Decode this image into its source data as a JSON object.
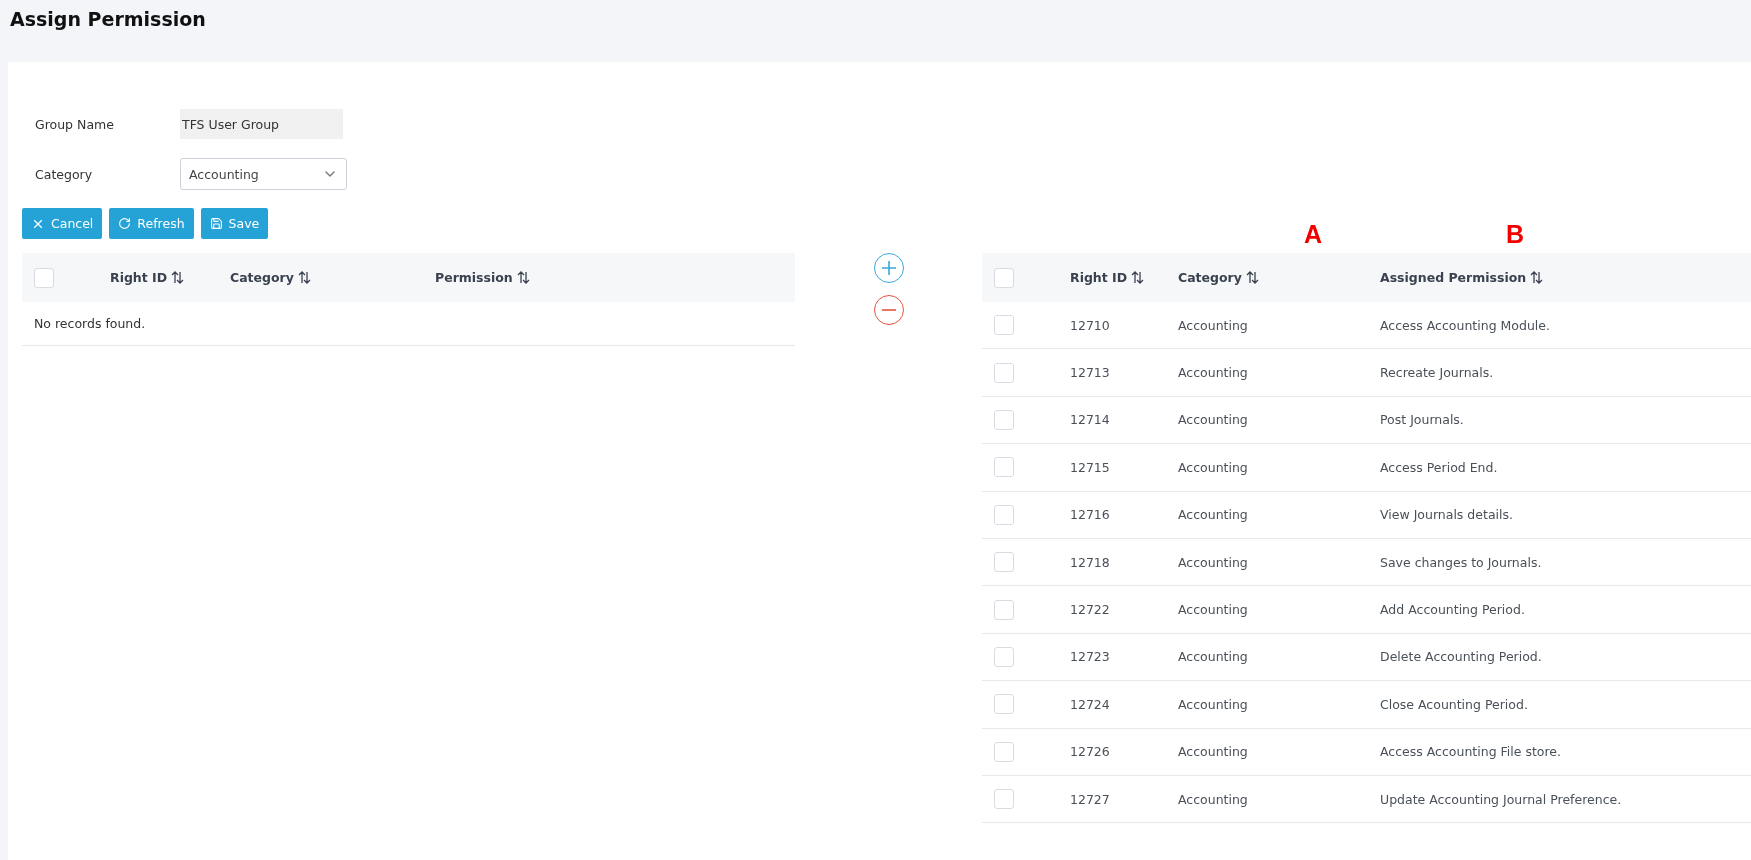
{
  "page_title": "Assign Permission",
  "form": {
    "group_name": {
      "label": "Group Name",
      "value": "TFS User Group"
    },
    "category": {
      "label": "Category",
      "value": "Accounting"
    }
  },
  "buttons": [
    {
      "kind": "cancel",
      "label": "Cancel"
    },
    {
      "kind": "refresh",
      "label": "Refresh"
    },
    {
      "kind": "save",
      "label": "Save"
    }
  ],
  "available_table": {
    "select_all_checked": false,
    "columns": [
      "Right ID",
      "Category",
      "Permission"
    ],
    "empty_message": "No records found."
  },
  "assigned_table": {
    "select_all_checked": false,
    "columns": [
      {
        "label": "Right ID"
      },
      {
        "label": "Category",
        "annotation": "A"
      },
      {
        "label": "Assigned Permission",
        "annotation": "B"
      }
    ],
    "rows": [
      {
        "id": "12710",
        "category": "Accounting",
        "permission": "Access Accounting Module.",
        "checked": false
      },
      {
        "id": "12713",
        "category": "Accounting",
        "permission": "Recreate Journals.",
        "checked": false
      },
      {
        "id": "12714",
        "category": "Accounting",
        "permission": "Post Journals.",
        "checked": false
      },
      {
        "id": "12715",
        "category": "Accounting",
        "permission": "Access Period End.",
        "checked": false
      },
      {
        "id": "12716",
        "category": "Accounting",
        "permission": "View Journals details.",
        "checked": false
      },
      {
        "id": "12718",
        "category": "Accounting",
        "permission": "Save changes to Journals.",
        "checked": false
      },
      {
        "id": "12722",
        "category": "Accounting",
        "permission": "Add Accounting Period.",
        "checked": false
      },
      {
        "id": "12723",
        "category": "Accounting",
        "permission": "Delete Accounting Period.",
        "checked": false
      },
      {
        "id": "12724",
        "category": "Accounting",
        "permission": "Close Acounting Period.",
        "checked": false
      },
      {
        "id": "12726",
        "category": "Accounting",
        "permission": "Access Accounting File store.",
        "checked": false
      },
      {
        "id": "12727",
        "category": "Accounting",
        "permission": "Update Accounting Journal Preference.",
        "checked": false
      }
    ]
  }
}
